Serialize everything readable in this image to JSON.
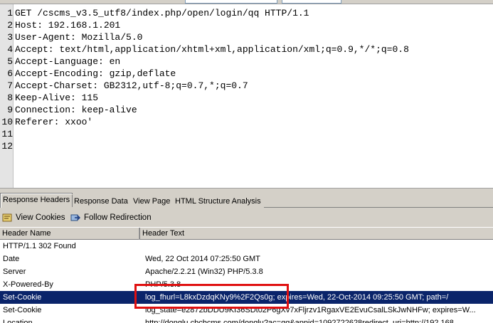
{
  "request": {
    "lines": [
      "GET /cscms_v3.5_utf8/index.php/open/login/qq HTTP/1.1",
      "Host: 192.168.1.201",
      "User-Agent: Mozilla/5.0",
      "Accept: text/html,application/xhtml+xml,application/xml;q=0.9,*/*;q=0.8",
      "Accept-Language: en",
      "Accept-Encoding: gzip,deflate",
      "Accept-Charset: GB2312,utf-8;q=0.7,*;q=0.7",
      "Keep-Alive: 115",
      "Connection: keep-alive",
      "Referer: xxoo'",
      "",
      ""
    ],
    "line_numbers": [
      "1",
      "2",
      "3",
      "4",
      "5",
      "6",
      "7",
      "8",
      "9",
      "10",
      "11",
      "12"
    ]
  },
  "tabs": [
    {
      "label": "Response Headers",
      "active": true
    },
    {
      "label": "Response Data",
      "active": false
    },
    {
      "label": "View Page",
      "active": false
    },
    {
      "label": "HTML Structure Analysis",
      "active": false
    }
  ],
  "toolbar": {
    "view_cookies": "View Cookies",
    "follow_redirection": "Follow Redirection"
  },
  "table": {
    "columns": [
      "Header Name",
      "Header Text"
    ],
    "rows": [
      {
        "name": "HTTP/1.1 302 Found",
        "value": ""
      },
      {
        "name": "Date",
        "value": "Wed, 22 Oct 2014 07:25:50 GMT"
      },
      {
        "name": "Server",
        "value": "Apache/2.2.21 (Win32) PHP/5.3.8"
      },
      {
        "name": "X-Powered-By",
        "value": "PHP/5.3.8"
      },
      {
        "name": "Set-Cookie",
        "value": "log_fhurl=L8kxDzdqKNy9%2F2Qs0g; expires=Wed, 22-Oct-2014 09:25:50 GMT; path=/",
        "selected": true
      },
      {
        "name": "Set-Cookie",
        "value": "log_state=e2872bDDU9KI36SDt02P6gXv7xFljrzv1RgaxVE2EvuCsalLSkJwNHFw; expires=W..."
      },
      {
        "name": "Location",
        "value": "http://donglu.cbcbcms.com/donglu?ac=qq&appid=1092722628redirect_uri=http://192.168..."
      }
    ]
  },
  "colors": {
    "selection": "#0a246a",
    "highlight_box": "#e01010",
    "chrome": "#d4d0c8"
  }
}
